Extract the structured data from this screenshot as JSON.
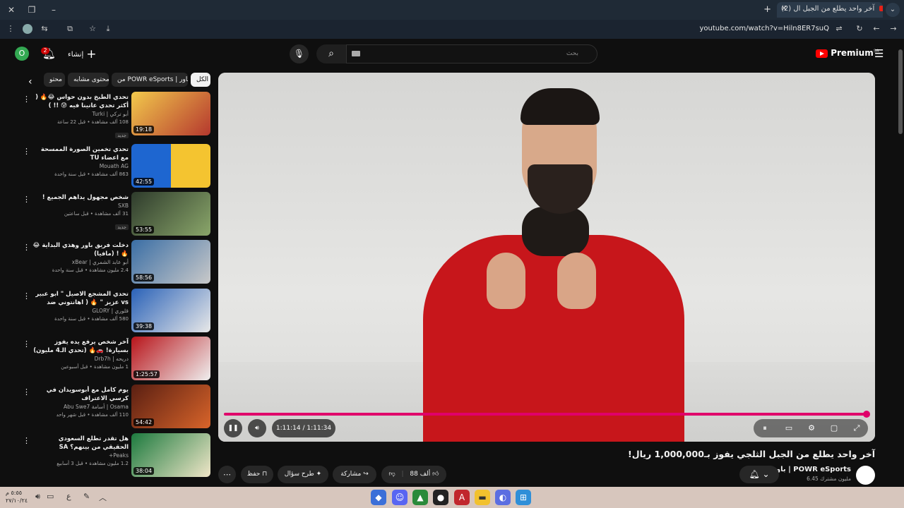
{
  "browser": {
    "tab_title": "(2) آخر واحد يطلع من الجبل ال",
    "url": "youtube.com/watch?v=Hiln8ER7suQ",
    "new_tab": "+",
    "close": "✕"
  },
  "header": {
    "avatar_letter": "O",
    "notification_count": "2",
    "create_label": "إنشاء",
    "search_placeholder": "بحث",
    "logo_text": "Premium",
    "logo_region": "SA"
  },
  "chips": [
    {
      "label": "الكل",
      "active": true
    },
    {
      "label": "من POWR eSports | باور",
      "active": false
    },
    {
      "label": "محتوى مشابه",
      "active": false
    },
    {
      "label": "محتو",
      "active": false
    }
  ],
  "recommendations": [
    {
      "title": "تحدي الطبخ بدون حواس 😂🔥 ( أكثر تحدي عانينا فيه 😰 !! )",
      "channel": "أبو تركي | Turki",
      "meta": "108 ألف مشاهدة • قبل 22 ساعة",
      "badge": "جديد",
      "duration": "19:18",
      "colors": [
        "#f2c94c",
        "#b5382e"
      ]
    },
    {
      "title": "تحدي تخمين الصورة الممسحة مع اعضاء TU",
      "channel": "Mouath AG",
      "meta": "863 ألف مشاهدة • قبل سنة واحدة",
      "badge": "",
      "duration": "42:55",
      "colors": [
        "#1e66d0",
        "#f4c430"
      ]
    },
    {
      "title": "شخص مجهول يداهم الجميع !",
      "channel": "SXB",
      "meta": "31 ألف مشاهدة • قبل ساعتين",
      "badge": "جديد",
      "duration": "53:55",
      "colors": [
        "#2e3b2c",
        "#8aa66a"
      ]
    },
    {
      "title": "دخلت فريق باور وهذي البداية 😂🔥 ! (مافيا)",
      "channel": "أبو عابد الشمري | xBear",
      "meta": "2.4 مليون مشاهدة • قبل سنة واحدة",
      "badge": "",
      "duration": "58:56",
      "colors": [
        "#3a6ea5",
        "#c9c9c9"
      ]
    },
    {
      "title": "تحدي المشجع الاصيل \" ابو عبير vs عزيز \" 🔥 ( اهانتوني ضد هلالي )",
      "channel": "قلوري | GLORY",
      "meta": "580 ألف مشاهدة • قبل سنة واحدة",
      "badge": "",
      "duration": "39:38",
      "colors": [
        "#2a62b8",
        "#e8e8e8"
      ]
    },
    {
      "title": "آخر شخص يرفع يده يفوز بسيارة! 🚗🔥 (تحدي الـ4 مليون)",
      "channel": "دريحه | Drb7h",
      "meta": "1 مليون مشاهدة • قبل أسبوعين",
      "badge": "",
      "duration": "1:25:57",
      "colors": [
        "#b8141a",
        "#efefef"
      ]
    },
    {
      "title": "يوم كامل مع أبوسويدان في كرسي الاعتراف",
      "channel": "Osama | أسامة Abu Swe7",
      "meta": "110 ألف مشاهدة • قبل شهر واحد",
      "badge": "",
      "duration": "54:42",
      "colors": [
        "#5a1f12",
        "#d8642a"
      ]
    },
    {
      "title": "هل تقدر تطلع السعودي الحقيقي من بينهم؟ SA",
      "channel": "Peaks+",
      "meta": "1.2 مليون مشاهدة • قبل 3 أسابيع",
      "badge": "",
      "duration": "38:04",
      "colors": [
        "#1c7a3e",
        "#f0e6c8"
      ]
    }
  ],
  "player": {
    "time": "1:11:14 / 1:11:34",
    "progress": 0.995
  },
  "video": {
    "title": "آخر واحد يطلع من الجبل الثلجي يفوز بـ1,000,000 ريال!",
    "channel": "باور | POWR eSports",
    "subscribers": "6.45 مليون مشترك",
    "likes": "88 ألف",
    "share": "مشاركة",
    "ask": "طرح سؤال",
    "save": "حفظ"
  },
  "taskbar": {
    "time": "٥:٥٥ م",
    "date": "٢٧/١٠/٢٤",
    "lang": "ع"
  },
  "colors": {
    "accent": "#e0006a",
    "youtube_red": "#ff0000",
    "background": "#0f0f0f"
  }
}
